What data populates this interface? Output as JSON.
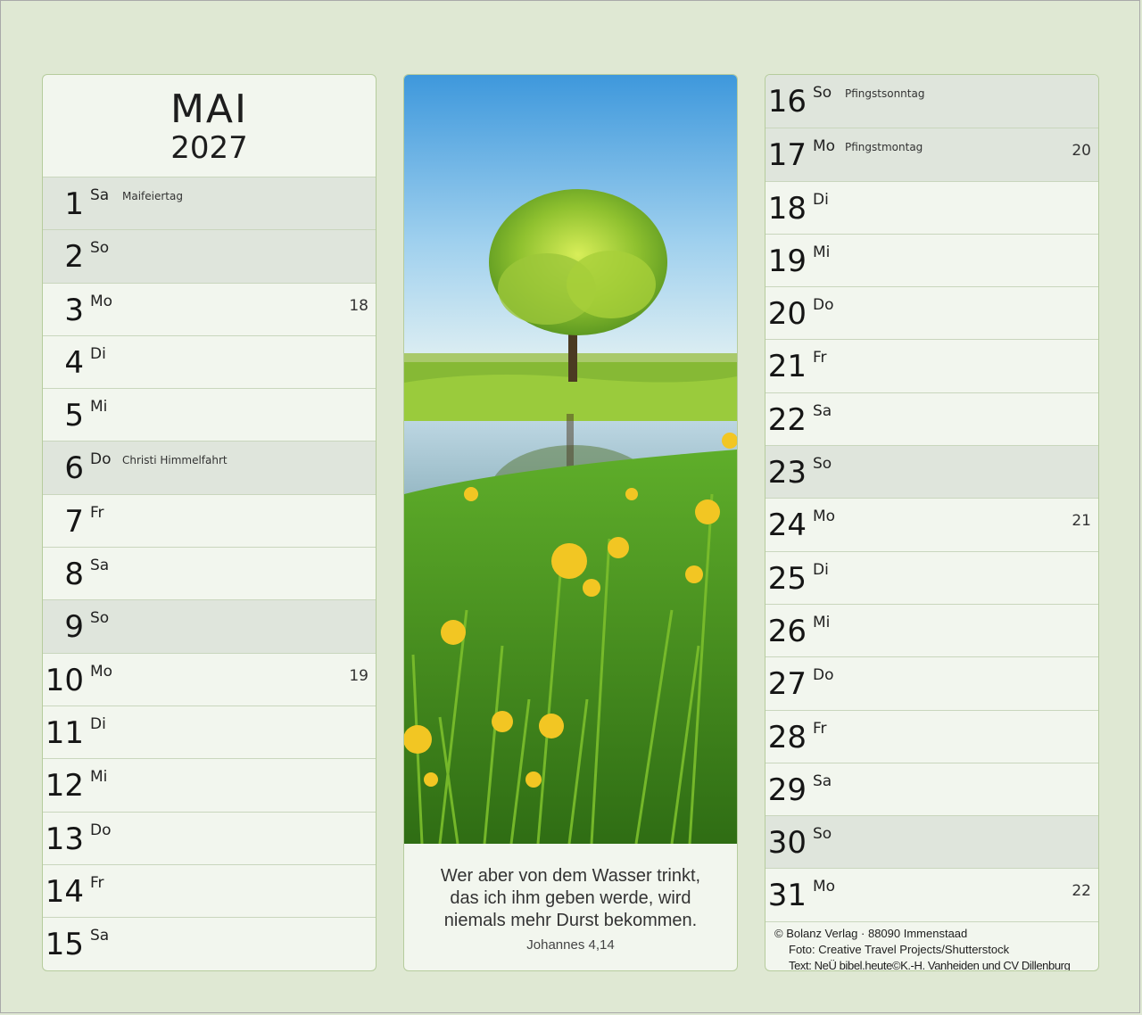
{
  "calendar": {
    "month": "MAI",
    "year": "2027",
    "left_days": [
      {
        "num": "1",
        "wd": "Sa",
        "event": "Maifeiertag",
        "week": "",
        "holiday": true
      },
      {
        "num": "2",
        "wd": "So",
        "event": "",
        "week": "",
        "holiday": true
      },
      {
        "num": "3",
        "wd": "Mo",
        "event": "",
        "week": "18",
        "holiday": false
      },
      {
        "num": "4",
        "wd": "Di",
        "event": "",
        "week": "",
        "holiday": false
      },
      {
        "num": "5",
        "wd": "Mi",
        "event": "",
        "week": "",
        "holiday": false
      },
      {
        "num": "6",
        "wd": "Do",
        "event": "Christi Himmelfahrt",
        "week": "",
        "holiday": true
      },
      {
        "num": "7",
        "wd": "Fr",
        "event": "",
        "week": "",
        "holiday": false
      },
      {
        "num": "8",
        "wd": "Sa",
        "event": "",
        "week": "",
        "holiday": false
      },
      {
        "num": "9",
        "wd": "So",
        "event": "",
        "week": "",
        "holiday": true
      },
      {
        "num": "10",
        "wd": "Mo",
        "event": "",
        "week": "19",
        "holiday": false
      },
      {
        "num": "11",
        "wd": "Di",
        "event": "",
        "week": "",
        "holiday": false
      },
      {
        "num": "12",
        "wd": "Mi",
        "event": "",
        "week": "",
        "holiday": false
      },
      {
        "num": "13",
        "wd": "Do",
        "event": "",
        "week": "",
        "holiday": false
      },
      {
        "num": "14",
        "wd": "Fr",
        "event": "",
        "week": "",
        "holiday": false
      },
      {
        "num": "15",
        "wd": "Sa",
        "event": "",
        "week": "",
        "holiday": false
      }
    ],
    "right_days": [
      {
        "num": "16",
        "wd": "So",
        "event": "Pfingstsonntag",
        "week": "",
        "holiday": true
      },
      {
        "num": "17",
        "wd": "Mo",
        "event": "Pfingstmontag",
        "week": "20",
        "holiday": true
      },
      {
        "num": "18",
        "wd": "Di",
        "event": "",
        "week": "",
        "holiday": false
      },
      {
        "num": "19",
        "wd": "Mi",
        "event": "",
        "week": "",
        "holiday": false
      },
      {
        "num": "20",
        "wd": "Do",
        "event": "",
        "week": "",
        "holiday": false
      },
      {
        "num": "21",
        "wd": "Fr",
        "event": "",
        "week": "",
        "holiday": false
      },
      {
        "num": "22",
        "wd": "Sa",
        "event": "",
        "week": "",
        "holiday": false
      },
      {
        "num": "23",
        "wd": "So",
        "event": "",
        "week": "",
        "holiday": true
      },
      {
        "num": "24",
        "wd": "Mo",
        "event": "",
        "week": "21",
        "holiday": false
      },
      {
        "num": "25",
        "wd": "Di",
        "event": "",
        "week": "",
        "holiday": false
      },
      {
        "num": "26",
        "wd": "Mi",
        "event": "",
        "week": "",
        "holiday": false
      },
      {
        "num": "27",
        "wd": "Do",
        "event": "",
        "week": "",
        "holiday": false
      },
      {
        "num": "28",
        "wd": "Fr",
        "event": "",
        "week": "",
        "holiday": false
      },
      {
        "num": "29",
        "wd": "Sa",
        "event": "",
        "week": "",
        "holiday": false
      },
      {
        "num": "30",
        "wd": "So",
        "event": "",
        "week": "",
        "holiday": true
      },
      {
        "num": "31",
        "wd": "Mo",
        "event": "",
        "week": "22",
        "holiday": false
      }
    ]
  },
  "quote": {
    "line1": "Wer aber von dem Wasser trinkt,",
    "line2": "das ich ihm geben werde, wird",
    "line3": "niemals mehr Durst bekommen.",
    "reference": "Johannes 4,14"
  },
  "credits": {
    "publisher": "© Bolanz Verlag · 88090 Immenstaad",
    "photo": "Foto: Creative Travel Projects/Shutterstock",
    "text": "Text: NeÜ bibel.heute©K.-H. Vanheiden und CV Dillenburg"
  },
  "colors": {
    "background": "#dfe8d3",
    "panel": "#f2f6ee",
    "holiday_row": "#dfe5dc",
    "panel_border": "#b6cc9d"
  }
}
